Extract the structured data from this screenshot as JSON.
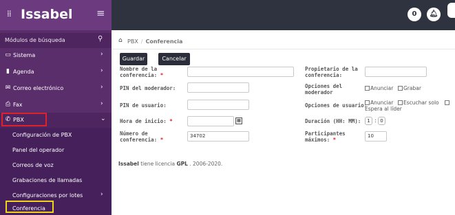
{
  "brand": {
    "name": "Issabel",
    "toggle_icon": "menu-icon"
  },
  "sidebar": {
    "search_label": "Módulos de búsqueda",
    "items": [
      {
        "label": "Sistema",
        "icon": "monitor-icon"
      },
      {
        "label": "Agenda",
        "icon": "book-icon"
      },
      {
        "label": "Correo electrónico",
        "icon": "envelope-icon"
      },
      {
        "label": "Fax",
        "icon": "printer-icon"
      },
      {
        "label": "PBX",
        "icon": "phone-icon"
      }
    ],
    "sub_items": [
      {
        "label": "Configuración de PBX"
      },
      {
        "label": "Panel del operador"
      },
      {
        "label": "Correos de voz"
      },
      {
        "label": "Grabaciones de llamadas"
      },
      {
        "label": "Configuraciones por lotes"
      },
      {
        "label": "Conferencia"
      }
    ]
  },
  "topbar": {
    "info_badge": "0"
  },
  "breadcrumb": {
    "root": "PBX",
    "current": "Conferencia"
  },
  "actions": {
    "save": "Guardar",
    "cancel": "Cancelar"
  },
  "form": {
    "conf_name_label": "Nombre de la conferencia:",
    "conf_name_value": "",
    "owner_label": "Propietario de la conferencia:",
    "owner_value": "",
    "moderator_pin_label": "PIN del moderador:",
    "moderator_pin_value": "",
    "moderator_options_label": "Opciones del moderador",
    "moderator_options": [
      "Anunciar",
      "Grabar"
    ],
    "user_pin_label": "PIN de usuario:",
    "user_pin_value": "",
    "user_options_label": "Opciones de usuario:",
    "user_options": [
      "Anunciar",
      "Escuchar solo",
      "Espera al líder"
    ],
    "start_time_label": "Hora de inicio:",
    "start_time_value": "",
    "duration_label": "Duración (HH: MM):",
    "duration_hours": "1",
    "duration_minutes": "0",
    "conf_number_label": "Número de conferencia:",
    "conf_number_value": "34702",
    "max_participants_label": "Participantes máximos:",
    "max_participants_value": "10",
    "required_mark": "*"
  },
  "footer": {
    "prefix": "Issabel",
    "middle": " tiene licencia ",
    "license": "GPL",
    "suffix": " . 2006-2020."
  },
  "colors": {
    "sidebar": "#5a2d6b",
    "topbar": "#2f323f",
    "highlight_pbx": "#e0202a",
    "highlight_conf": "#f2d21b"
  }
}
